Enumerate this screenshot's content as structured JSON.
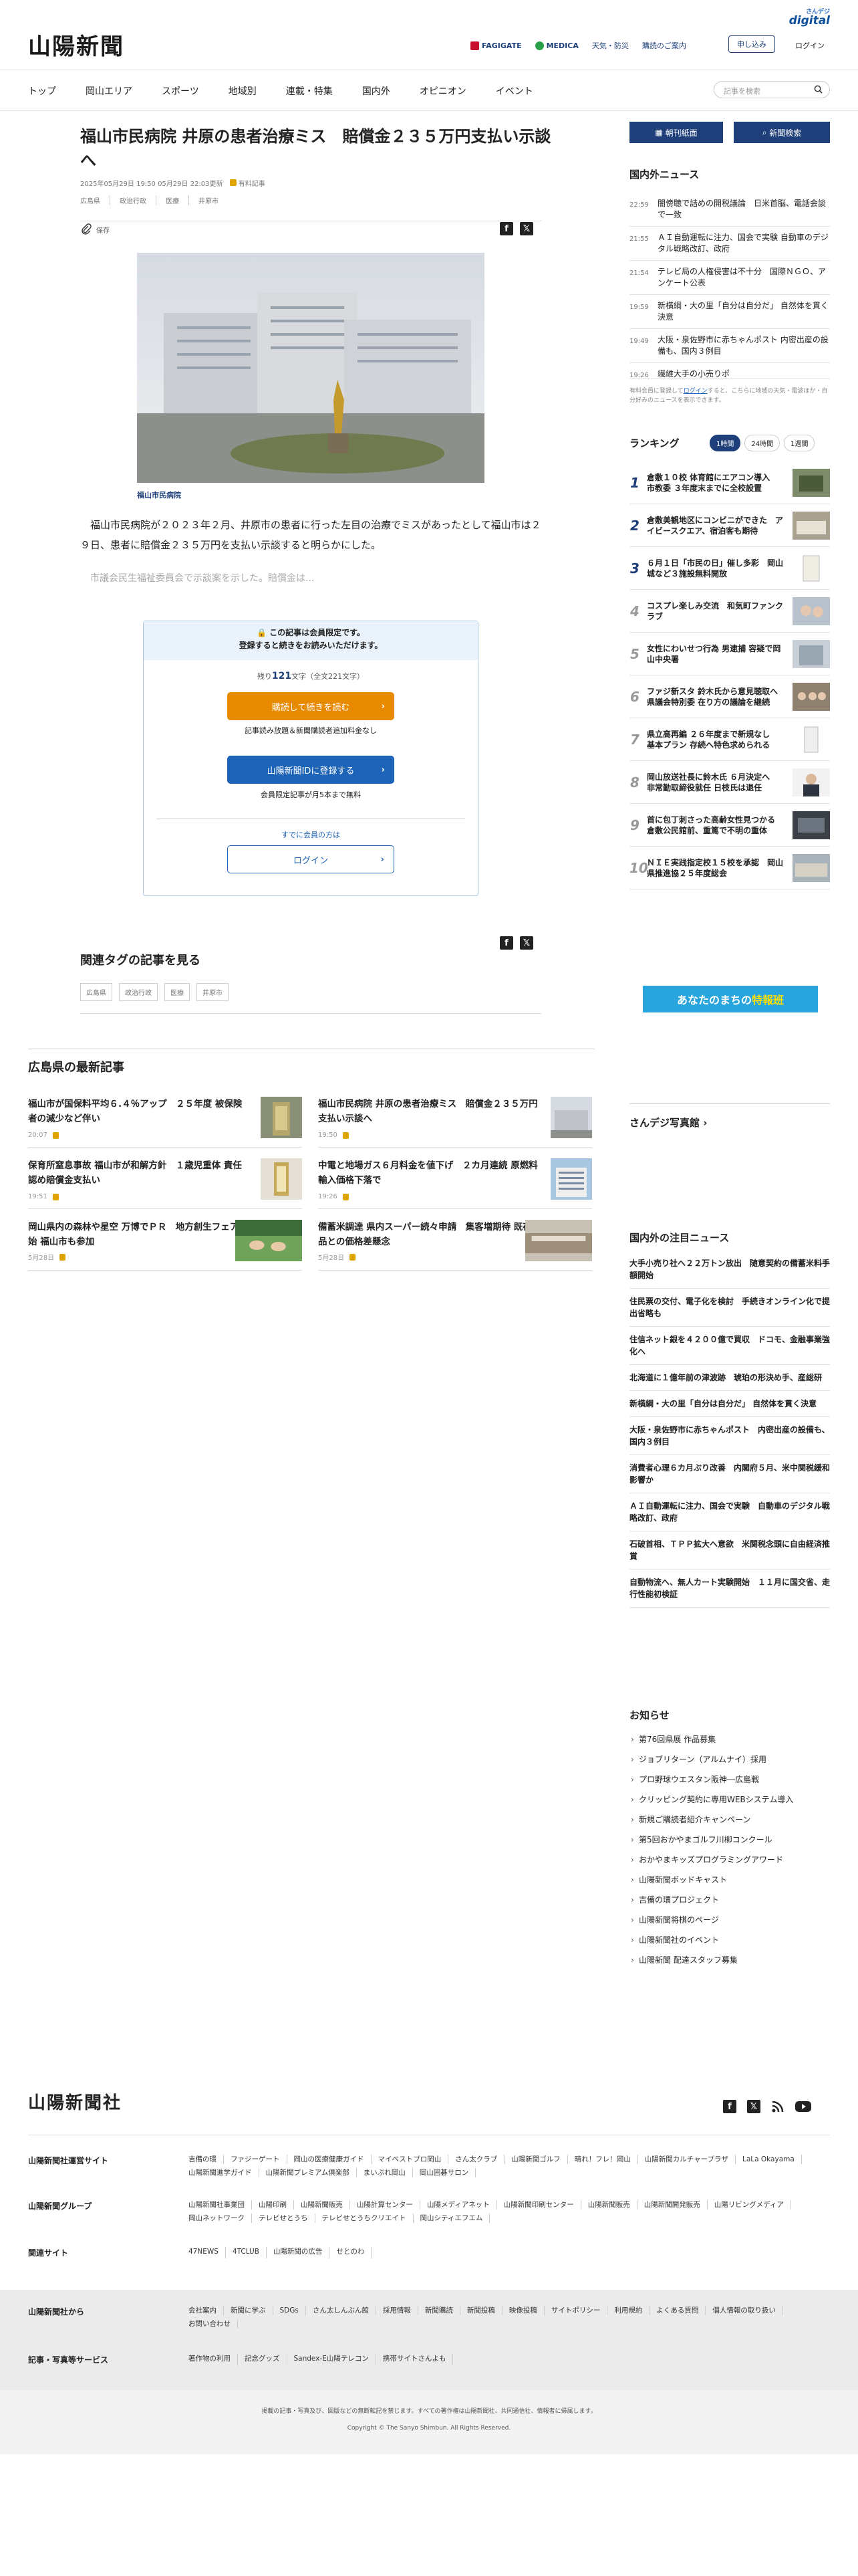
{
  "header": {
    "logo": "山陽新聞",
    "digital_small": "さんデジ",
    "digital_big": "digital",
    "links": [
      "FAGIGATE",
      "MEDICA",
      "天気・防災",
      "購読のご案内"
    ],
    "subscribe": "申し込み",
    "login": "ログイン"
  },
  "nav": {
    "items": [
      "トップ",
      "岡山エリア",
      "スポーツ",
      "地域別",
      "連載・特集",
      "国内外",
      "オピニオン",
      "イベント"
    ],
    "search_placeholder": "記事を検索"
  },
  "article": {
    "title": "福山市民病院 井原の患者治療ミス　賠償金２３５万円支払い示談へ",
    "date": "2025年05月29日 19:50 05月29日 22:03更新",
    "paid_label": "有料記事",
    "tags": [
      "広島県",
      "政治行政",
      "医療",
      "井原市"
    ],
    "save_label": "保存",
    "caption": "福山市民病院",
    "lead": "福山市民病院が２０２３年２月、井原市の患者に行った左目の治療でミスがあったとして福山市は２９日、患者に賠償金２３５万円を支払い示談すると明らかにした。",
    "blurred": "市議会民生福祉委員会で示談案を示した。賠償金は..."
  },
  "paywall": {
    "line1": "この記事は会員限定です。",
    "line2": "登録すると続きをお読みいただけます。",
    "remain_prefix": "残り",
    "remain_count": "121",
    "remain_suffix": "文字（全文221文字）",
    "read_button": "購読して続きを読む",
    "note1": "記事読み放題＆新聞購読者追加料金なし",
    "register_button": "山陽新聞IDに登録する",
    "note2": "会員限定記事が月5本まで無料",
    "member_text": "すでに会員の方は",
    "login_button": "ログイン"
  },
  "related": {
    "heading": "関連タグの記事を見る",
    "tags": [
      "広島県",
      "政治行政",
      "医療",
      "井原市"
    ]
  },
  "latest": {
    "heading": "広島県の最新記事",
    "items": [
      {
        "title": "福山市が国保料平均６.４％アップ　２５年度 被保険者の減少など伴い",
        "time": "20:07"
      },
      {
        "title": "福山市民病院 井原の患者治療ミス　賠償金２３５万円支払い示談へ",
        "time": "19:50"
      },
      {
        "title": "保育所窒息事故 福山市が和解方針　１歳児重体 責任認め賠償金支払い",
        "time": "19:51"
      },
      {
        "title": "中電と地場ガス６月料金を値下げ　２カ月連続 原燃料輸入価格下落で",
        "time": "19:26"
      },
      {
        "title": "岡山県内の森林や星空 万博でＰＲ　地方創生フェア開始 福山市も参加",
        "time": "5月28日"
      },
      {
        "title": "備蓄米調達 県内スーパー続々申請　集客増期待 既存品との価格差懸念",
        "time": "5月28日"
      }
    ]
  },
  "sidebar": {
    "btn_paper": "朝刊紙面",
    "btn_search": "新聞検索",
    "news_heading": "国内外ニュース",
    "news": [
      {
        "time": "22:59",
        "title": "闇傍聴で詰めの開税議論　日米首脳、電話会談で一致"
      },
      {
        "time": "21:55",
        "title": "ＡＩ自動運転に注力、国会で実験 自動車のデジタル戦略改訂、政府"
      },
      {
        "time": "21:54",
        "title": "テレビ局の人権侵害は不十分　国際ＮＧＯ、アンケート公表"
      },
      {
        "time": "19:59",
        "title": "新横綱・大の里「自分は自分だ」 自然体を貫く決意"
      },
      {
        "time": "19:49",
        "title": "大阪・泉佐野市に赤ちゃんポスト 内密出産の設備も、国内３例目"
      },
      {
        "time": "19:26",
        "title": "繊維大手の小売りポ"
      }
    ],
    "news_note_1": "有料会員に登録して",
    "news_note_link": "ログイン",
    "news_note_2": "すると、こちらに地域の天気・電波ほか・自分好みのニュースを表示できます。",
    "ranking_heading": "ランキング",
    "ranking_tabs": [
      "1時間",
      "24時間",
      "1週間"
    ],
    "ranking": [
      {
        "rank": "1",
        "title": "倉敷１０校 体育館にエアコン導入　市教委 ３年度末までに全校設置"
      },
      {
        "rank": "2",
        "title": "倉敷美観地区にコンビニができた　アイビースクエア、宿泊客も期待"
      },
      {
        "rank": "3",
        "title": "６月１日「市民の日」催し多彩　岡山城など３施設無料開放"
      },
      {
        "rank": "4",
        "title": "コスプレ楽しみ交流　和気町ファンクラブ"
      },
      {
        "rank": "5",
        "title": "女性にわいせつ行為 男逮捕 容疑で岡山中央署"
      },
      {
        "rank": "6",
        "title": "ファジ新スタ 鈴木氏から意見聴取へ　県議会特別委 在り方の議論を継続"
      },
      {
        "rank": "7",
        "title": "県立高再編 ２６年度まで新規なし　基本プラン 存続へ特色求められる"
      },
      {
        "rank": "8",
        "title": "岡山放送社長に鈴木氏 ６月決定へ　非常勤取締役就任 日枝氏は退任"
      },
      {
        "rank": "9",
        "title": "首に包丁刺さった高齢女性見つかる　倉敷公民館前、重篤で不明の重体"
      },
      {
        "rank": "10",
        "title": "ＮＩＥ実践指定校１５校を承認　岡山県推進協２５年度総会"
      }
    ],
    "ad_prefix": "あなたのまちの",
    "ad_highlight": "特報班",
    "photo_heading": "さんデジ写真館",
    "local_heading": "国内外の注目ニュース",
    "local": [
      "大手小売り社へ２２万トン放出　随意契約の備蓄米料手額開始",
      "住民票の交付、電子化を検討　手続きオンライン化で提出省略も",
      "住信ネット銀を４２００億で買収　ドコモ、金融事業強化へ",
      "北海道に１億年前の津波跡　琥珀の形決め手、産総研",
      "新横綱・大の里「自分は自分だ」 自然体を貫く決意",
      "大阪・泉佐野市に赤ちゃんポスト　内密出産の設備も、国内３例目",
      "消費者心理６カ月ぶり改善　内閣府５月、米中関税緩和影響か",
      "ＡＩ自動運転に注力、国会で実験　自動車のデジタル戦略改訂、政府",
      "石破首相、ＴＰＰ拡大へ意欲　米関税念頭に自由経済推賞",
      "自動物流へ、無人カート実験開始　１１月に国交省、走行性能初検証"
    ],
    "notice_heading": "お知らせ",
    "notices": [
      "第76回県展 作品募集",
      "ジョブリターン（アルムナイ）採用",
      "プロ野球ウエスタン阪神―広島戦",
      "クリッピング契約に専用WEBシステム導入",
      "新規ご購読者紹介キャンペーン",
      "第5回おかやまゴルフ川柳コンクール",
      "おかやまキッズプログラミングアワード",
      "山陽新聞ボッドキャスト",
      "吉備の環プロジェクト",
      "山陽新聞将棋のページ",
      "山陽新聞社のイベント",
      "山陽新聞 配達スタッフ募集"
    ]
  },
  "footer": {
    "logo": "山陽新聞社",
    "rows": [
      {
        "heading": "山陽新聞社運営サイト",
        "links": [
          "吉備の環",
          "ファジーゲート",
          "岡山の医療健康ガイド",
          "マイベストプロ岡山",
          "さん太クラブ",
          "山陽新聞ゴルフ",
          "晴れ！フレ！岡山",
          "山陽新聞カルチャープラザ",
          "LaLa Okayama",
          "山陽新聞進学ガイド",
          "山陽新聞プレミアム倶楽部",
          "まいぷれ岡山",
          "岡山囲碁サロン"
        ]
      },
      {
        "heading": "山陽新聞グループ",
        "links": [
          "山陽新聞社事業団",
          "山陽印刷",
          "山陽新聞販売",
          "山陽計算センター",
          "山陽メディアネット",
          "山陽新聞印刷センター",
          "山陽新聞販売",
          "山陽新聞開発販売",
          "山陽リビングメディア",
          "岡山ネットワーク",
          "テレビせとうち",
          "テレビせとうちクリエイト",
          "岡山シティエフエム"
        ]
      },
      {
        "heading": "関連サイト",
        "links": [
          "47NEWS",
          "4TCLUB",
          "山陽新聞の広告",
          "せとのわ"
        ]
      },
      {
        "heading": "山陽新聞社から",
        "links": [
          "会社案内",
          "新聞に学ぶ",
          "SDGs",
          "さん太しんぶん館",
          "採用情報",
          "新聞購読",
          "新聞投稿",
          "映像投稿",
          "サイトポリシー",
          "利用規約",
          "よくある質問",
          "個人情報の取り扱い",
          "お問い合わせ"
        ]
      },
      {
        "heading": "記事・写真等サービス",
        "links": [
          "著作物の利用",
          "記念グッズ",
          "Sandex-E山陽テレコン",
          "携帯サイトさんよも"
        ]
      }
    ],
    "copy1": "掲載の記事・写真及び、図版などの無断転記を禁じます。すべての著作権は山陽新聞社、共同通信社、情報者に帰属します。",
    "copy2": "Copyright © The Sanyo Shimbun. All Rights Reserved."
  },
  "colors": {
    "navy": "#1e3f7a",
    "orange": "#e88a00",
    "blue": "#1d63b7"
  }
}
